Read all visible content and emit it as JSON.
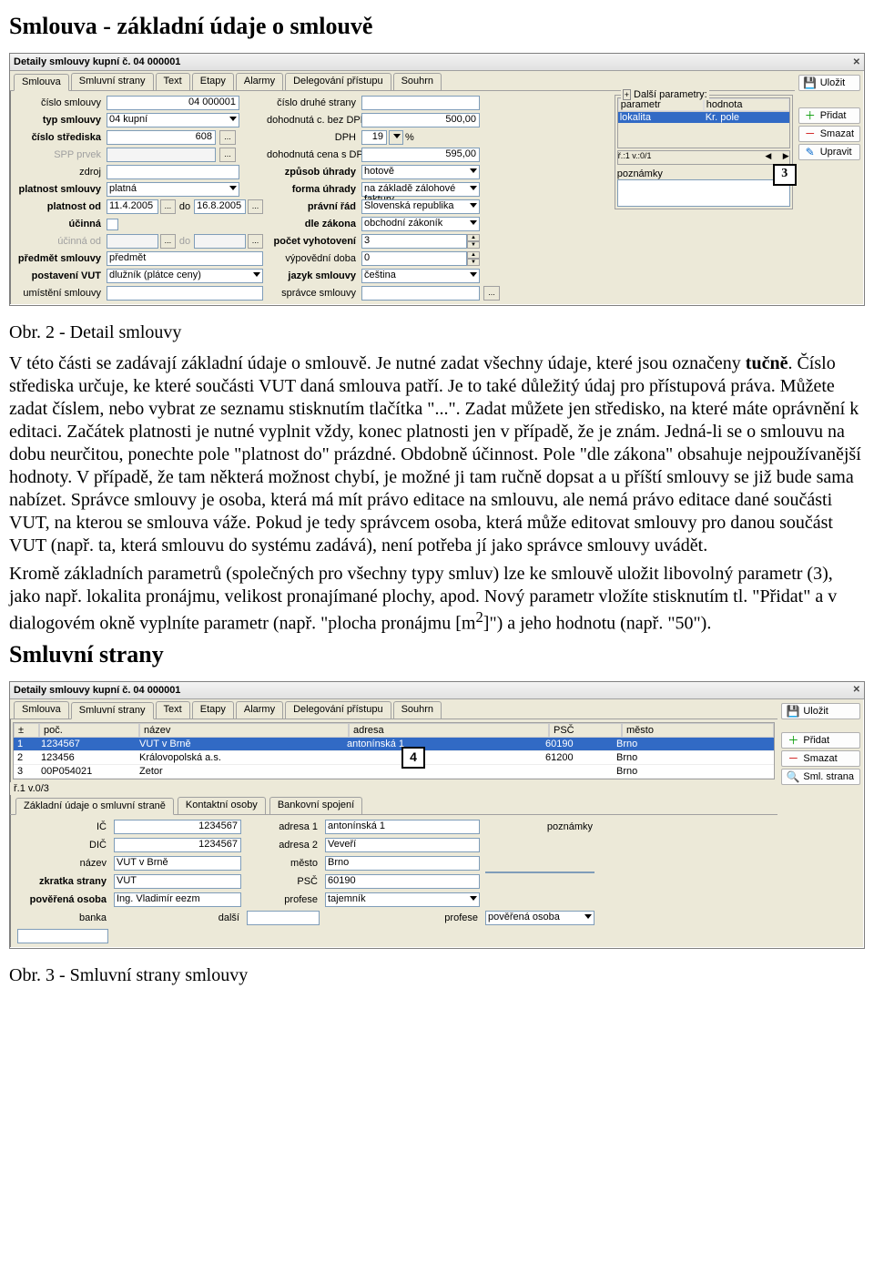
{
  "heading1": "Smlouva - základní údaje o smlouvě",
  "win1": {
    "title": "Detaily smlouvy kupní č. 04 000001",
    "tabs": [
      "Smlouva",
      "Smluvní strany",
      "Text",
      "Etapy",
      "Alarmy",
      "Delegování přístupu",
      "Souhrn"
    ],
    "save": "Uložit",
    "btn_add": "Přidat",
    "btn_del": "Smazat",
    "btn_edit": "Upravit",
    "labels": {
      "cislo": "číslo smlouvy",
      "typ": "typ smlouvy",
      "stredisko": "číslo střediska",
      "spp": "SPP prvek",
      "zdroj": "zdroj",
      "platnost_sml": "platnost smlouvy",
      "platnost_od": "platnost od",
      "do": "do",
      "ucinna": "účinná",
      "ucinna_od": "účinná od",
      "predmet": "předmět smlouvy",
      "postaveni": "postavení VUT",
      "umisteni": "umístění smlouvy",
      "cislo2": "číslo druhé strany",
      "bezdph": "dohodnutá c. bez DPH",
      "dph": "DPH",
      "sdph": "dohodnutá cena s DPH",
      "zpusob": "způsob úhrady",
      "forma": "forma úhrady",
      "rad": "právní řád",
      "zakon": "dle zákona",
      "vyhot": "počet vyhotovení",
      "vypov": "výpovědní doba",
      "jazyk": "jazyk smlouvy",
      "spravce": "správce smlouvy"
    },
    "vals": {
      "cislo": "04 000001",
      "typ": "04  kupní",
      "stredisko": "608",
      "spp": "",
      "zdroj": "",
      "platnost_sml": "platná",
      "platnost_od": "11.4.2005",
      "platnost_do": "16.8.2005",
      "ucinna_od": "",
      "ucinna_do": "",
      "predmet": "předmět",
      "postaveni": "dlužník (plátce ceny)",
      "umisteni": "",
      "cislo2": "",
      "bezdph": "500,00",
      "dph": "19",
      "dph_pct": "%",
      "sdph": "595,00",
      "zpusob": "hotově",
      "forma": "na základě zálohové faktury",
      "rad": "Slovenská republika",
      "zakon": "obchodní zákoník",
      "vyhot": "3",
      "vypov": "0",
      "jazyk": "čeština",
      "spravce": ""
    },
    "params": {
      "legend": "Další parametry:",
      "hdr1": "parametr",
      "hdr2": "hodnota",
      "row1": "lokalita",
      "row2": "Kr. pole",
      "scroll": "ř.:1 v.:0/1",
      "notes": "poznámky"
    }
  },
  "figcap1": "Obr. 2 - Detail smlouvy",
  "para1a": "V této části se zadávají základní údaje o smlouvě. Je nutné zadat všechny údaje, které jsou označeny ",
  "para1b": "tučně",
  "para1c": ". Číslo střediska určuje, ke které součásti VUT daná smlouva patří. Je to také důležitý údaj pro přístupová práva. Můžete zadat číslem, nebo vybrat ze seznamu stisknutím tlačítka \"...\". Zadat můžete jen středisko, na které máte oprávnění k editaci. Začátek platnosti je nutné vyplnit vždy, konec platnosti jen v případě, že je znám. Jedná-li se o smlouvu na dobu neurčitou, ponechte pole \"platnost do\" prázdné. Obdobně účinnost. Pole \"dle zákona\" obsahuje nejpoužívanější hodnoty. V případě, že tam některá možnost chybí, je možné ji tam ručně dopsat a u příští smlouvy se již bude sama nabízet. Správce smlouvy je osoba, která má mít právo editace na smlouvu, ale nemá právo editace dané součásti VUT, na kterou se smlouva váže. Pokud je tedy správcem osoba, která může editovat smlouvy pro danou součást VUT (např. ta, která smlouvu do systému zadává), není potřeba jí jako správce smlouvy uvádět.",
  "para2": "Kromě základních parametrů (společných pro všechny typy smluv) lze ke smlouvě uložit libovolný parametr (3), jako např. lokalita pronájmu, velikost pronajímané plochy, apod. Nový parametr vložíte stisknutím tl. \"Přidat\" a v dialogovém okně vyplníte parametr (např. \"plocha pronájmu [m",
  "para2b": "2",
  "para2c": "]\") a jeho hodnotu (např. \"50\").",
  "heading2": "Smluvní strany",
  "win2": {
    "title": "Detaily smlouvy kupní č. 04 000001",
    "tabs": [
      "Smlouva",
      "Smluvní strany",
      "Text",
      "Etapy",
      "Alarmy",
      "Delegování přístupu",
      "Souhrn"
    ],
    "save": "Uložit",
    "btn_add": "Přidat",
    "btn_del": "Smazat",
    "btn_sml": "Sml. strana",
    "ghdr": {
      "poc": "poč.",
      "nazev": "název",
      "adresa": "adresa",
      "psc": "PSČ",
      "mesto": "město"
    },
    "rows": [
      {
        "n": "1",
        "ic": "1234567",
        "nazev": "VUT v Brně",
        "adresa": "antonínská 1",
        "psc": "60190",
        "mesto": "Brno"
      },
      {
        "n": "2",
        "ic": "123456",
        "nazev": "Královopolská a.s.",
        "adresa": "",
        "psc": "61200",
        "mesto": "Brno"
      },
      {
        "n": "3",
        "ic": "00P054021",
        "nazev": "Zetor",
        "adresa": "",
        "psc": "",
        "mesto": "Brno"
      }
    ],
    "status": "ř.1 v.0/3",
    "subtabs": [
      "Základní údaje o smluvní straně",
      "Kontaktní osoby",
      "Bankovní spojení"
    ],
    "sub": {
      "ic_l": "IČ",
      "ic": "1234567",
      "dic_l": "DIČ",
      "dic": "1234567",
      "nazev_l": "název",
      "nazev": "VUT v Brně",
      "zkr_l": "zkratka strany",
      "zkr": "VUT",
      "osoba_l": "pověřená osoba",
      "osoba": "Ing. Vladimír eezm",
      "dalsi_l": "další",
      "dalsi": "",
      "adr1_l": "adresa 1",
      "adr1": "antonínská 1",
      "adr2_l": "adresa 2",
      "adr2": "Veveří",
      "mesto_l": "město",
      "mesto": "Brno",
      "psc_l": "PSČ",
      "psc": "60190",
      "prof_l": "profese",
      "prof": "tajemník",
      "prof2_l": "profese",
      "prof2": "pověřená osoba",
      "pozn_l": "poznámky",
      "banka_l": "banka"
    }
  },
  "figcap2": "Obr. 3 - Smluvní strany smlouvy",
  "callout3": "3",
  "callout4": "4"
}
